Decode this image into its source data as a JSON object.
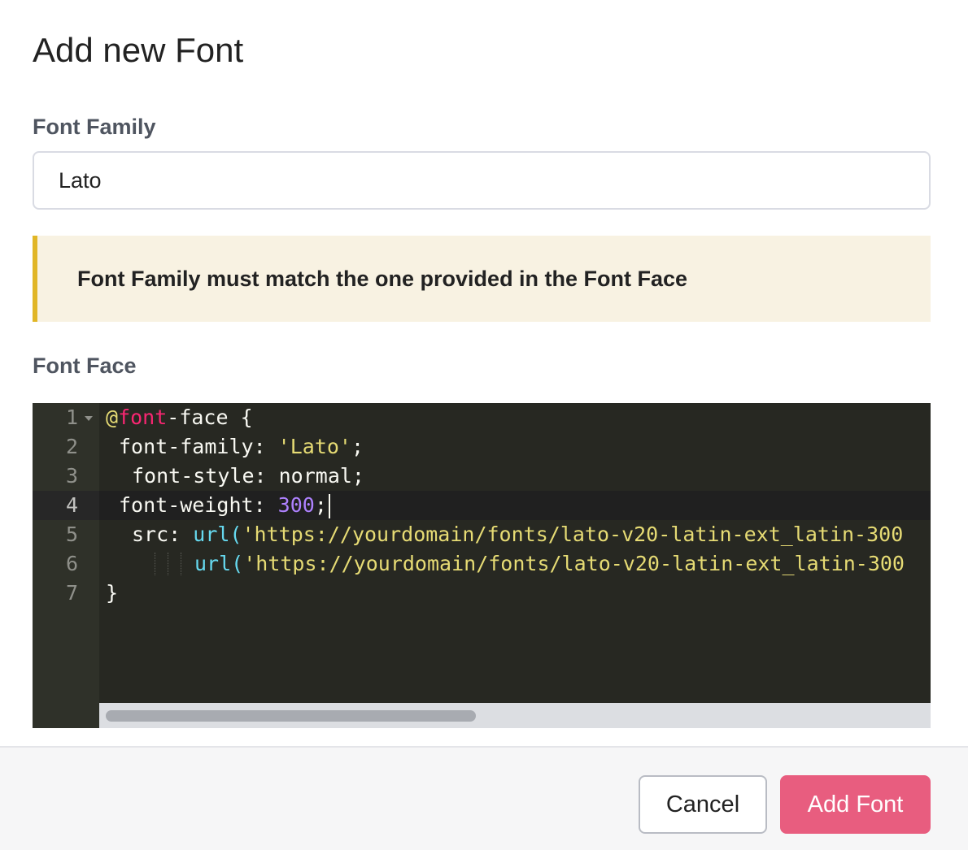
{
  "dialog": {
    "title": "Add new Font",
    "font_family": {
      "label": "Font Family",
      "value": "Lato"
    },
    "notice": {
      "text": "Font Family must match the one provided in the Font Face",
      "accent_color": "#e1b626"
    },
    "font_face": {
      "label": "Font Face",
      "line_numbers": [
        "1",
        "2",
        "3",
        "4",
        "5",
        "6",
        "7"
      ],
      "lines": [
        {
          "at": "@",
          "kw": "font",
          "rest": "-face {"
        },
        {
          "prop": "font-family: ",
          "str": "'Lato'",
          "end": ";"
        },
        {
          "prop": "font-style: normal;"
        },
        {
          "prop": "font-weight: ",
          "num": "300",
          "end": ";"
        },
        {
          "prop": "src: ",
          "fn": "url(",
          "str": "'https://yourdomain/fonts/lato-v20-latin-ext_latin-300"
        },
        {
          "fn": "url(",
          "str": "'https://yourdomain/fonts/lato-v20-latin-ext_latin-300"
        },
        {
          "rest": "}"
        }
      ]
    }
  },
  "footer": {
    "cancel_label": "Cancel",
    "add_label": "Add Font",
    "add_color": "#e85d7f"
  }
}
